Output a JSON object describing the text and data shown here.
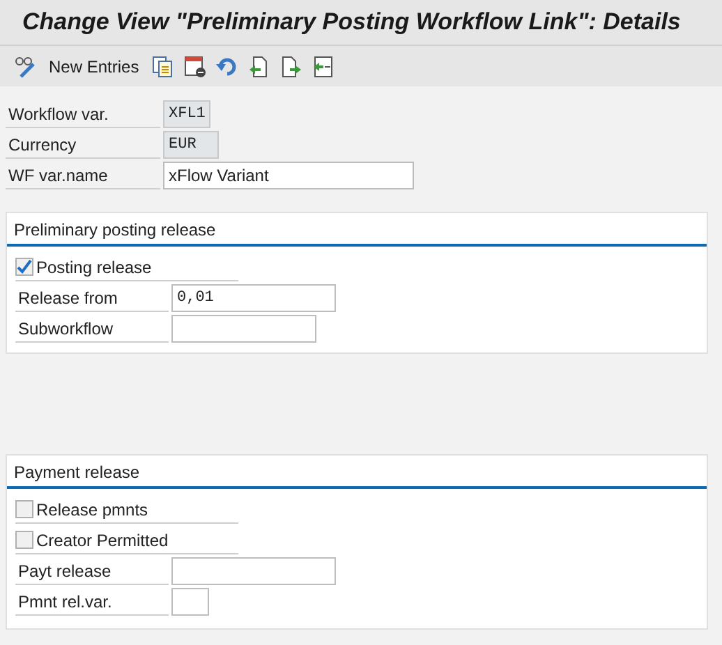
{
  "title": "Change View \"Preliminary Posting Workflow Link\": Details",
  "toolbar": {
    "new_entries": "New Entries"
  },
  "header_fields": [
    {
      "label": "Workflow var.",
      "value": "XFL1",
      "kind": "readonly"
    },
    {
      "label": "Currency",
      "value": "EUR",
      "kind": "readonly"
    },
    {
      "label": "WF var.name",
      "value": "xFlow Variant",
      "kind": "input"
    }
  ],
  "sections": [
    {
      "title": "Preliminary posting release",
      "items": [
        {
          "kind": "checkbox",
          "label": "Posting release",
          "checked": true
        },
        {
          "kind": "field",
          "label": "Release from",
          "value": "0,01"
        },
        {
          "kind": "field",
          "label": "Subworkflow"
        }
      ]
    },
    {
      "title": "Payment release",
      "items": [
        {
          "kind": "checkbox",
          "label": "Release pmnts",
          "checked": false
        },
        {
          "kind": "checkbox",
          "label": "Creator Permitted",
          "checked": false
        },
        {
          "kind": "field",
          "label": "Payt release"
        },
        {
          "kind": "field",
          "label": "Pmnt rel.var."
        }
      ]
    }
  ]
}
